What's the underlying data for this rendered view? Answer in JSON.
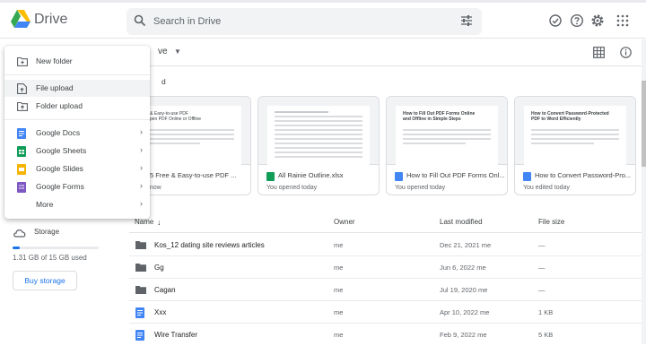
{
  "app": {
    "name": "Drive"
  },
  "search": {
    "placeholder": "Search in Drive"
  },
  "main": {
    "title": "My Drive",
    "title_visible": "ve",
    "suggested_visible": "d"
  },
  "menu": {
    "items": [
      {
        "label": "New folder",
        "icon": "new-folder-icon"
      },
      {
        "label": "File upload",
        "icon": "file-upload-icon"
      },
      {
        "label": "Folder upload",
        "icon": "folder-upload-icon"
      },
      {
        "label": "Google Docs",
        "icon": "docs-icon",
        "color": "#4285f4"
      },
      {
        "label": "Google Sheets",
        "icon": "sheets-icon",
        "color": "#0f9d58"
      },
      {
        "label": "Google Slides",
        "icon": "slides-icon",
        "color": "#f4b400"
      },
      {
        "label": "Google Forms",
        "icon": "forms-icon",
        "color": "#7e57c2"
      },
      {
        "label": "More",
        "icon": ""
      }
    ]
  },
  "storage": {
    "label": "Storage",
    "used_text": "1.31 GB of 15 GB used",
    "used_fraction": 0.087,
    "buy_label": "Buy storage"
  },
  "cards": [
    {
      "name": "5 Free & Easy-to-use PDF ...",
      "sub": "just now",
      "icon_color": "#ea4335",
      "thumb_lines": [
        "e & Easy-to-use PDF",
        "Open PDF Online or Offline"
      ]
    },
    {
      "name": "All Rainie Outline.xlsx",
      "sub": "You opened today",
      "icon_color": "#0f9d58",
      "thumb_lines": []
    },
    {
      "name": "How to Fill Out PDF Forms Onl...",
      "sub": "You opened today",
      "icon_color": "#4285f4",
      "thumb_lines": [
        "How to Fill Out PDF Forms Online",
        "and Offline in Simple Steps"
      ]
    },
    {
      "name": "How to Convert Password-Pro...",
      "sub": "You edited today",
      "icon_color": "#4285f4",
      "thumb_lines": [
        "How to Convert Password-Protected",
        "PDF to Word Efficiently"
      ]
    }
  ],
  "table": {
    "headers": {
      "name": "Name",
      "owner": "Owner",
      "modified": "Last modified",
      "size": "File size"
    },
    "rows": [
      {
        "name": "Kos_12 dating site reviews articles",
        "owner": "me",
        "modified": "Dec 21, 2021",
        "modified_by": "me",
        "size": "—",
        "type": "folder"
      },
      {
        "name": "Gg",
        "owner": "me",
        "modified": "Jun 6, 2022",
        "modified_by": "me",
        "size": "—",
        "type": "folder"
      },
      {
        "name": "Cagan",
        "owner": "me",
        "modified": "Jul 19, 2020",
        "modified_by": "me",
        "size": "—",
        "type": "folder"
      },
      {
        "name": "Xxx",
        "owner": "me",
        "modified": "Apr 10, 2022",
        "modified_by": "me",
        "size": "1 KB",
        "type": "doc"
      },
      {
        "name": "Wire Transfer",
        "owner": "me",
        "modified": "Feb 9, 2022",
        "modified_by": "me",
        "size": "5 KB",
        "type": "doc"
      }
    ]
  },
  "colors": {
    "accent": "#1a73e8",
    "folder": "#5f6368",
    "doc": "#4285f4"
  }
}
